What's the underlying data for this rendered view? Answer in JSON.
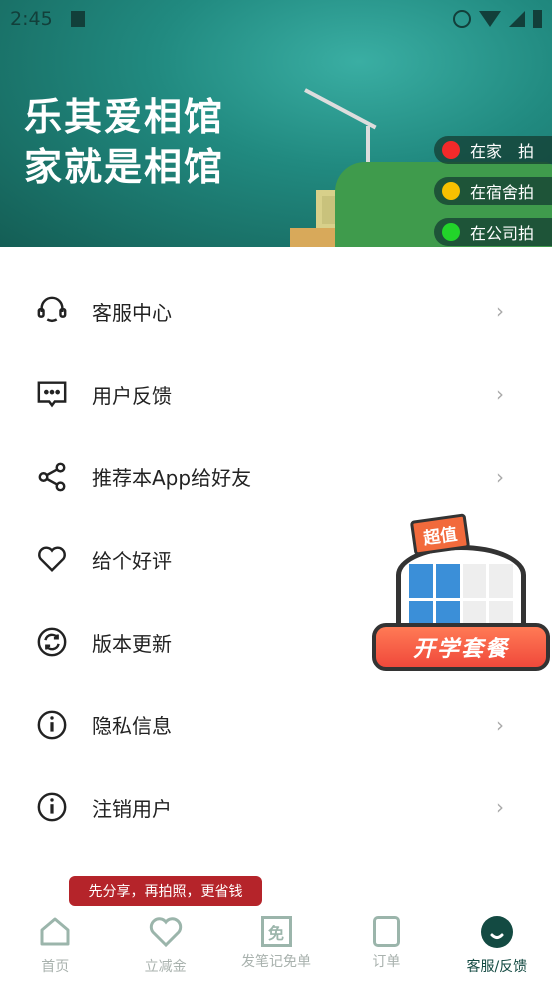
{
  "status": {
    "time": "2:45"
  },
  "banner": {
    "line1": "乐其爱相馆",
    "line2": "家就是相馆",
    "options": [
      {
        "label": "在家　拍",
        "color": "#f22a2a"
      },
      {
        "label": "在宿舍拍",
        "color": "#f7c000"
      },
      {
        "label": "在公司拍",
        "color": "#22d42a"
      }
    ]
  },
  "menu": [
    {
      "label": "客服中心",
      "icon": "headset-icon"
    },
    {
      "label": "用户反馈",
      "icon": "message-icon"
    },
    {
      "label": "推荐本App给好友",
      "icon": "share-icon"
    },
    {
      "label": "给个好评",
      "icon": "heart-icon"
    },
    {
      "label": "版本更新",
      "icon": "refresh-icon"
    },
    {
      "label": "隐私信息",
      "icon": "info-icon"
    },
    {
      "label": "注销用户",
      "icon": "info-icon"
    }
  ],
  "promo": {
    "badge": "超值",
    "title": "开学套餐"
  },
  "tooltip": "先分享，再拍照，更省钱",
  "tabs": [
    {
      "label": "首页"
    },
    {
      "label": "立减金"
    },
    {
      "label": "发笔记免单",
      "glyph": "免"
    },
    {
      "label": "订单"
    },
    {
      "label": "客服/反馈"
    }
  ],
  "colors": {
    "accent": "#134a42",
    "tab_inactive": "#9bb5ab",
    "tooltip": "#b5242a"
  }
}
